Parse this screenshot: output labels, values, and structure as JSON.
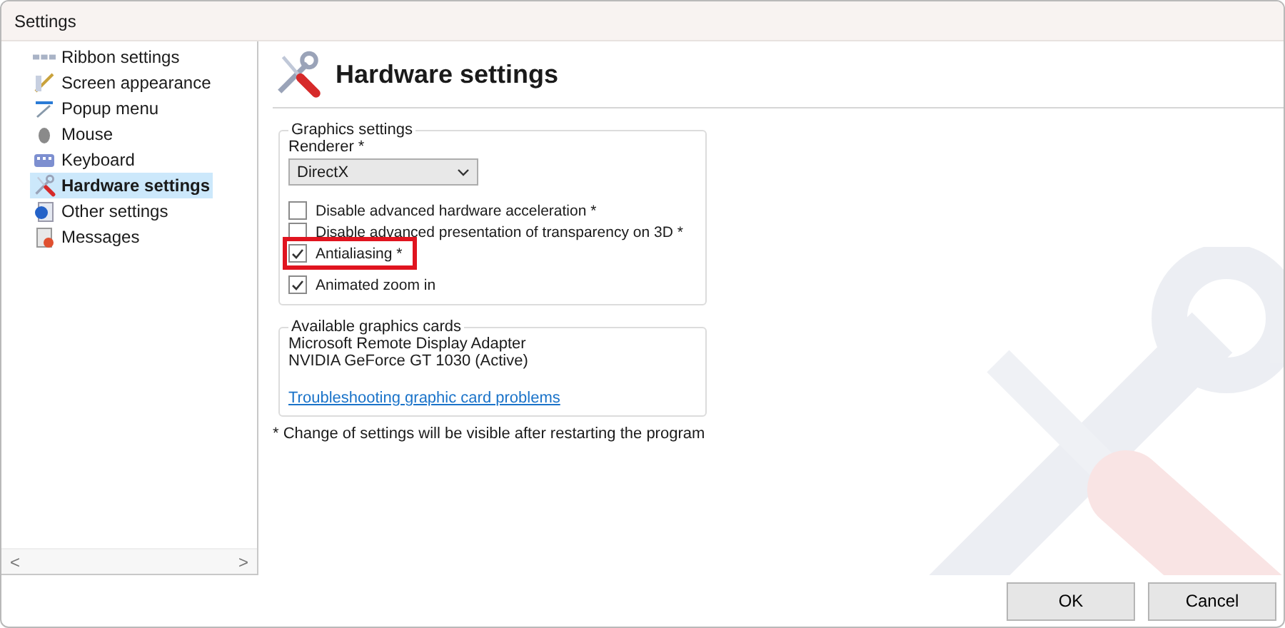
{
  "window": {
    "title": "Settings"
  },
  "sidebar": {
    "items": [
      {
        "label": "Ribbon settings",
        "selected": false
      },
      {
        "label": "Screen appearance",
        "selected": false
      },
      {
        "label": "Popup menu",
        "selected": false
      },
      {
        "label": "Mouse",
        "selected": false
      },
      {
        "label": "Keyboard",
        "selected": false
      },
      {
        "label": "Hardware settings",
        "selected": true
      },
      {
        "label": "Other settings",
        "selected": false
      },
      {
        "label": "Messages",
        "selected": false
      }
    ],
    "scroll_left": "<",
    "scroll_right": ">"
  },
  "page": {
    "title": "Hardware settings",
    "graphics": {
      "legend": "Graphics settings",
      "renderer_label": "Renderer *",
      "renderer_value": "DirectX",
      "options": [
        {
          "label": "Disable advanced hardware acceleration *",
          "checked": false,
          "highlighted": false
        },
        {
          "label": "Disable advanced presentation of transparency on 3D *",
          "checked": false,
          "highlighted": false
        },
        {
          "label": "Antialiasing *",
          "checked": true,
          "highlighted": true
        },
        {
          "label": "Animated zoom in",
          "checked": true,
          "highlighted": false
        }
      ]
    },
    "cards": {
      "legend": "Available graphics cards",
      "items": [
        "Microsoft Remote Display Adapter",
        "NVIDIA GeForce GT 1030 (Active)"
      ],
      "link": "Troubleshooting graphic card problems"
    },
    "footnote": "*  Change of settings will be visible after restarting the program"
  },
  "buttons": [
    "OK",
    "Cancel"
  ]
}
